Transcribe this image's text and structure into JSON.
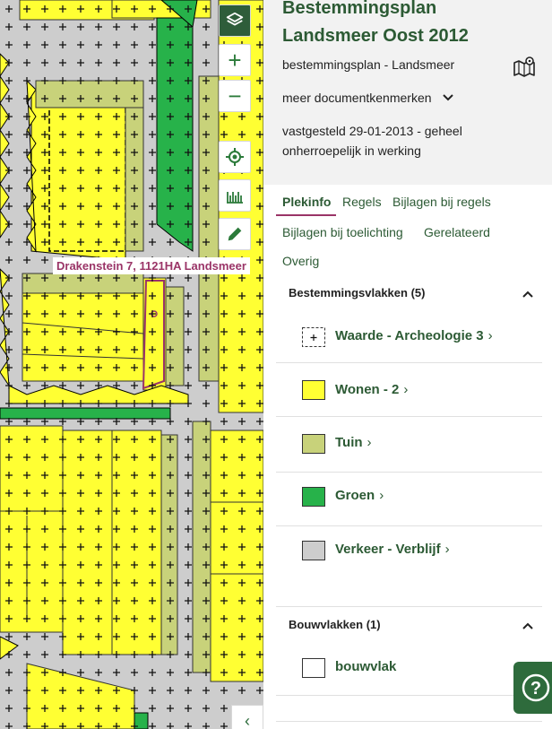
{
  "map": {
    "address_label": "Drakenstein 7, 1121HA Landsmeer",
    "controls": [
      {
        "name": "layers-button",
        "icon": "layers-icon",
        "glyph": ""
      },
      {
        "name": "zoom-in-button",
        "icon": "plus-icon",
        "glyph": "+"
      },
      {
        "name": "zoom-out-button",
        "icon": "minus-icon",
        "glyph": "−"
      },
      {
        "name": "locate-button",
        "icon": "crosshair-icon",
        "glyph": ""
      },
      {
        "name": "measure-button",
        "icon": "ruler-icon",
        "glyph": ""
      },
      {
        "name": "draw-button",
        "icon": "pencil-icon",
        "glyph": ""
      }
    ],
    "collapse_glyph": "‹",
    "colors": {
      "wonen": "#ffff33",
      "tuin": "#c8d27a",
      "groen": "#27b24a",
      "verkeer": "#cdcdcd",
      "selection": "#9a3467"
    }
  },
  "plan": {
    "title": "Bestemmingsplan Landsmeer Oost 2012",
    "subtitle": "bestemmingsplan - Landsmeer",
    "meer": "meer documentkenmerken",
    "status": "vastgesteld 29-01-2013 - geheel onherroepelijk in werking"
  },
  "tabs": [
    {
      "label": "Plekinfo",
      "active": true
    },
    {
      "label": "Regels",
      "active": false
    },
    {
      "label": "Bijlagen bij regels",
      "active": false
    },
    {
      "label": "Bijlagen bij toelichting",
      "active": false
    },
    {
      "label": "Gerelateerd",
      "active": false
    },
    {
      "label": "Overig",
      "active": false
    }
  ],
  "bestemmingsvlakken": {
    "title": "Bestemmingsvlakken (5)",
    "items": [
      {
        "label": "Waarde - Archeologie 3",
        "color": "#ffffff",
        "pattern": "cross"
      },
      {
        "label": "Wonen - 2",
        "color": "#ffff33"
      },
      {
        "label": "Tuin",
        "color": "#c8d27a"
      },
      {
        "label": "Groen",
        "color": "#27b24a"
      },
      {
        "label": "Verkeer - Verblijf",
        "color": "#cdcdcd"
      }
    ]
  },
  "bouwvlakken": {
    "title": "Bouwvlakken (1)",
    "items": [
      {
        "label": "bouwvlak",
        "color": "#ffffff"
      }
    ]
  },
  "help": {
    "glyph": "?"
  }
}
